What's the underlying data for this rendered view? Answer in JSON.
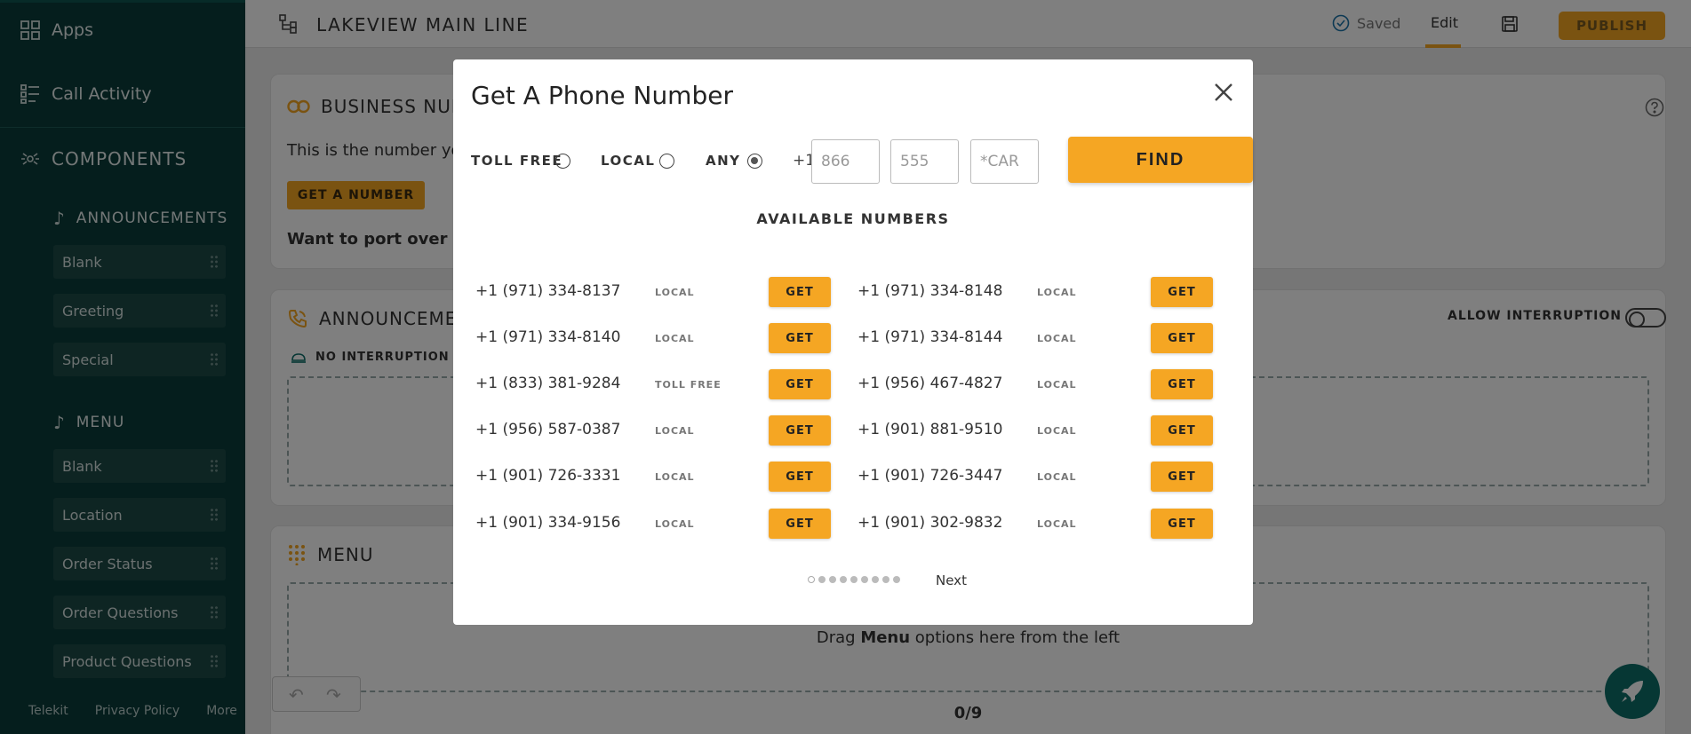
{
  "sidebar": {
    "nav": [
      {
        "label": "Apps"
      },
      {
        "label": "Call Activity"
      }
    ],
    "components_label": "COMPONENTS",
    "announcements_label": "ANNOUNCEMENTS",
    "announcement_items": [
      "Blank",
      "Greeting",
      "Special"
    ],
    "menu_label": "MENU",
    "menu_items": [
      "Blank",
      "Location",
      "Order Status",
      "Order Questions",
      "Product Questions"
    ],
    "footer": [
      "Telekit",
      "Privacy Policy",
      "More"
    ]
  },
  "topbar": {
    "title": "LAKEVIEW MAIN LINE",
    "saved_label": "Saved",
    "edit_label": "Edit",
    "publish_label": "PUBLISH"
  },
  "main": {
    "business_card": {
      "title": "BUSINESS NUM",
      "description": "This is the number yo",
      "get_number_label": "GET A NUMBER",
      "port_text": "Want to port over a p"
    },
    "announcements_card": {
      "title": "ANNOUNCEME",
      "allow_interruption_label": "ALLOW INTERRUPTION",
      "no_interruption_label": "NO INTERRUPTION"
    },
    "menu_card": {
      "title": "MENU",
      "drag_prefix": "Drag ",
      "drag_bold": "Menu",
      "drag_suffix": " options here from the left",
      "count": "0/9"
    }
  },
  "modal": {
    "title": "Get A Phone Number",
    "filters": {
      "toll_free_label": "TOLL FREE",
      "local_label": "LOCAL",
      "any_label": "ANY",
      "selected": "ANY",
      "country_code": "+1",
      "area_code_placeholder": "866",
      "prefix_placeholder": "555",
      "vanity_placeholder": "*CAR",
      "find_label": "FIND"
    },
    "available_title": "AVAILABLE NUMBERS",
    "get_label": "GET",
    "numbers": [
      {
        "number": "+1 (971) 334-8137",
        "type": "LOCAL"
      },
      {
        "number": "+1 (971) 334-8148",
        "type": "LOCAL"
      },
      {
        "number": "+1 (971) 334-8140",
        "type": "LOCAL"
      },
      {
        "number": "+1 (971) 334-8144",
        "type": "LOCAL"
      },
      {
        "number": "+1 (833) 381-9284",
        "type": "TOLL FREE"
      },
      {
        "number": "+1 (956) 467-4827",
        "type": "LOCAL"
      },
      {
        "number": "+1 (956) 587-0387",
        "type": "LOCAL"
      },
      {
        "number": "+1 (901) 881-9510",
        "type": "LOCAL"
      },
      {
        "number": "+1 (901) 726-3331",
        "type": "LOCAL"
      },
      {
        "number": "+1 (901) 726-3447",
        "type": "LOCAL"
      },
      {
        "number": "+1 (901) 334-9156",
        "type": "LOCAL"
      },
      {
        "number": "+1 (901) 302-9832",
        "type": "LOCAL"
      }
    ],
    "pagination": {
      "pages": 9,
      "current": 1,
      "next_label": "Next"
    }
  },
  "colors": {
    "sidebar_bg": "#0b3d3a",
    "accent": "#f5a623",
    "rocket_bg": "#0d6e68"
  }
}
